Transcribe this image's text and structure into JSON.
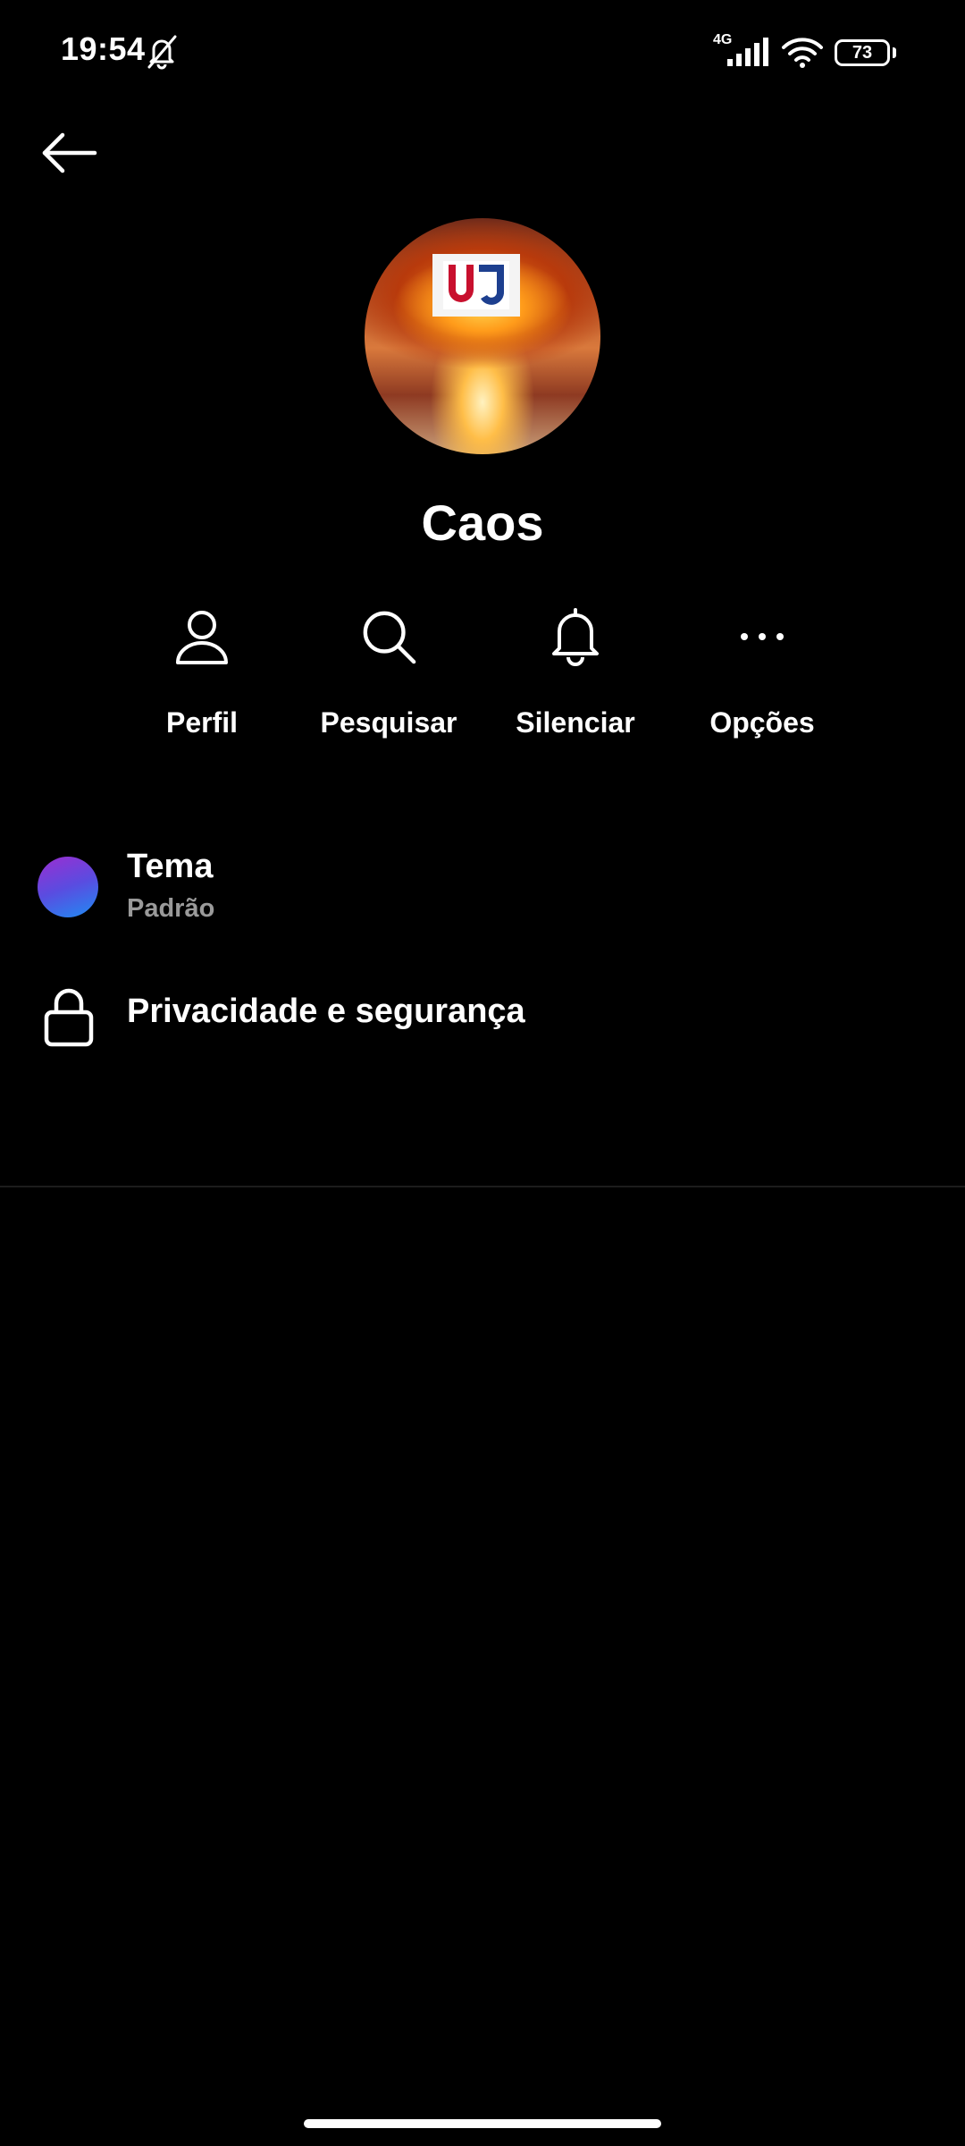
{
  "status_bar": {
    "time": "19:54",
    "network": "4G",
    "battery": "73"
  },
  "header": {
    "back_icon": "arrow-left-icon"
  },
  "profile": {
    "name": "Caos",
    "avatar_logo_text": "UJ"
  },
  "actions": [
    {
      "label": "Perfil",
      "icon": "person-icon"
    },
    {
      "label": "Pesquisar",
      "icon": "search-icon"
    },
    {
      "label": "Silenciar",
      "icon": "bell-icon"
    },
    {
      "label": "Opções",
      "icon": "more-horizontal-icon"
    }
  ],
  "menu": {
    "theme": {
      "title": "Tema",
      "value": "Padrão",
      "colors": [
        "#9b2ed1",
        "#1f8cf3"
      ]
    },
    "privacy": {
      "label": "Privacidade e segurança",
      "icon": "lock-icon"
    }
  },
  "colors": {
    "background": "#000000",
    "text": "#ffffff",
    "secondary_text": "#9a9a9a"
  }
}
